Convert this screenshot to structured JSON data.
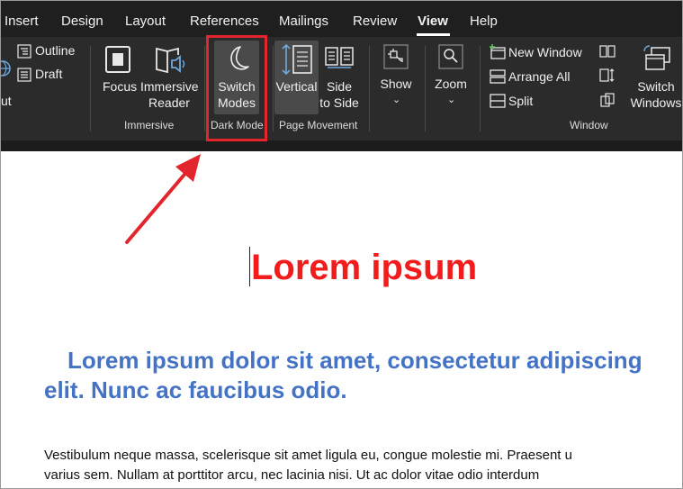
{
  "tabs": [
    {
      "label": "Insert"
    },
    {
      "label": "Design"
    },
    {
      "label": "Layout"
    },
    {
      "label": "References"
    },
    {
      "label": "Mailings"
    },
    {
      "label": "Review"
    },
    {
      "label": "View",
      "active": true
    },
    {
      "label": "Help"
    }
  ],
  "ribbon": {
    "views": {
      "outline": "Outline",
      "draft": "Draft",
      "partial_label": "ut"
    },
    "immersive": {
      "focus": "Focus",
      "immersive_reader_1": "Immersive",
      "immersive_reader_2": "Reader",
      "group_label": "Immersive"
    },
    "dark_mode": {
      "switch_modes_1": "Switch",
      "switch_modes_2": "Modes",
      "group_label": "Dark Mode"
    },
    "page_movement": {
      "vertical": "Vertical",
      "side_1": "Side",
      "side_2": "to Side",
      "group_label": "Page Movement"
    },
    "show": {
      "label": "Show"
    },
    "zoom": {
      "label": "Zoom"
    },
    "window": {
      "new_window": "New Window",
      "arrange_all": "Arrange All",
      "split": "Split",
      "switch_1": "Switch",
      "switch_2": "Windows",
      "group_label": "Window"
    }
  },
  "colors": {
    "highlight_box": "#e3262e",
    "arrow": "#e3262e",
    "title_red": "#f21c1c",
    "heading_blue": "#4472c4",
    "ribbon_bg": "#2b2b2b",
    "tab_bg": "#1f1f1f"
  },
  "document": {
    "title": "Lorem ipsum",
    "heading": "Lorem ipsum dolor sit amet, consectetur adipiscing elit. Nunc ac faucibus odio.",
    "body_line_1": "Vestibulum neque massa, scelerisque sit amet ligula eu, congue molestie mi. Praesent u",
    "body_line_2": "varius sem. Nullam at porttitor arcu, nec lacinia nisi. Ut ac dolor vitae odio interdum"
  },
  "icons": {
    "outline": "outline-icon",
    "draft": "draft-icon",
    "focus": "focus-icon",
    "immersive_reader": "immersive-reader-icon",
    "switch_modes": "moon-icon",
    "vertical": "vertical-page-icon",
    "side_to_side": "side-to-side-icon",
    "show": "show-icon",
    "zoom": "magnifier-icon",
    "new_window": "new-window-icon",
    "arrange_all": "arrange-all-icon",
    "split": "split-icon",
    "switch_windows": "switch-windows-icon"
  }
}
